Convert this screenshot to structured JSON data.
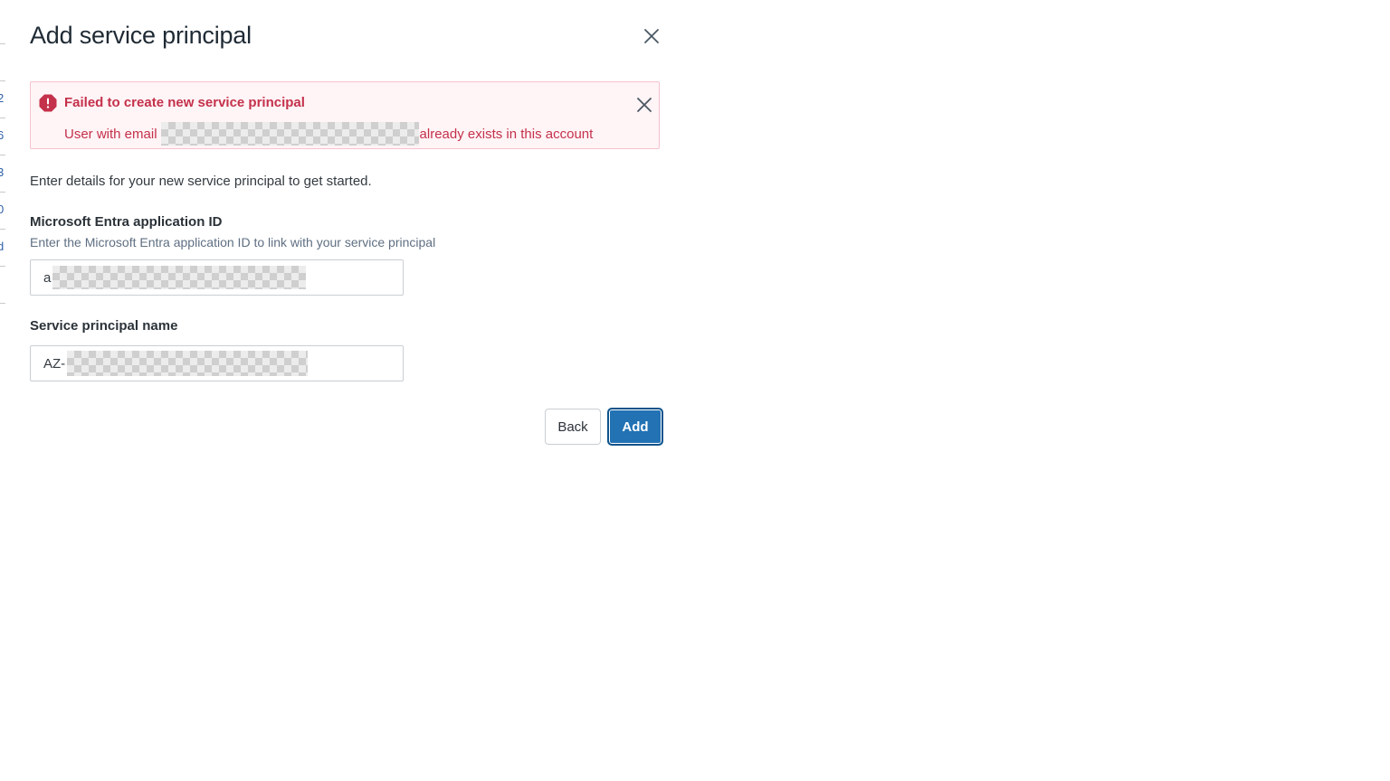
{
  "backdrop": {
    "fragments": [
      "2",
      "6",
      "3",
      "0",
      "d"
    ]
  },
  "modal": {
    "title": "Add service principal"
  },
  "alert": {
    "title": "Failed to create new service principal",
    "message_prefix": "User with email",
    "message_redacted_start": "",
    "message_suffix": "already exists in this account",
    "accent_color": "#c4314b"
  },
  "form": {
    "intro": "Enter details for your new service principal to get started.",
    "app_id": {
      "label": "Microsoft Entra application ID",
      "help": "Enter the Microsoft Entra application ID to link with your service principal",
      "value_visible": "a"
    },
    "name": {
      "label": "Service principal name",
      "value_visible": "AZ-"
    }
  },
  "buttons": {
    "back": "Back",
    "add": "Add",
    "primary_color": "#2272b4"
  }
}
